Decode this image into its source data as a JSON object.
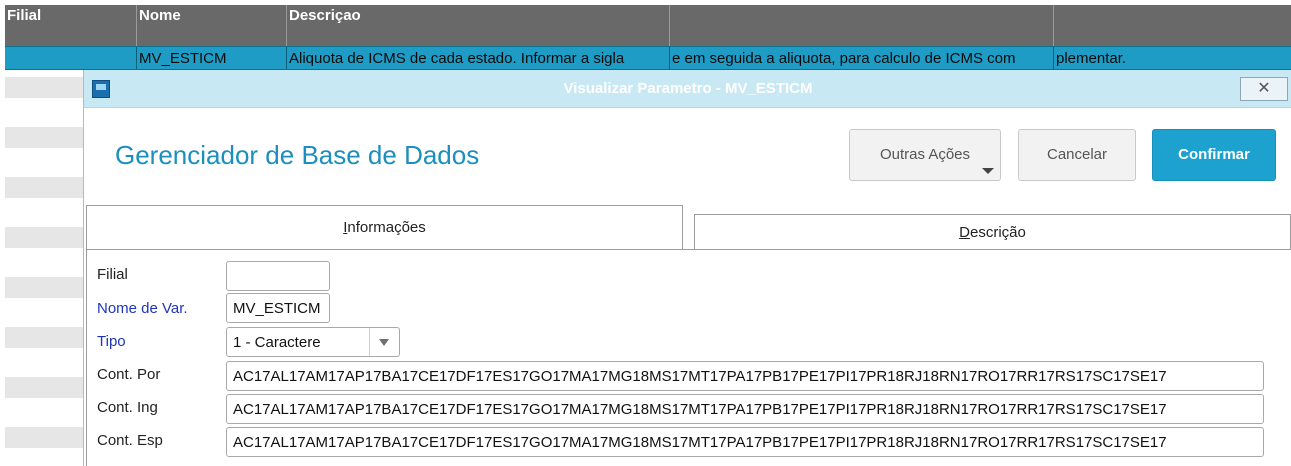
{
  "grid": {
    "headers": [
      "Filial",
      "Nome",
      "Descriçao",
      "",
      ""
    ],
    "selected_row": [
      "",
      "MV_ESTICM",
      "Aliquota de ICMS de cada estado. Informar a sigla",
      "e em seguida a aliquota, para calculo de ICMS com",
      "plementar."
    ]
  },
  "dialog": {
    "title": "Visualizar Parametro - MV_ESTICM",
    "close_glyph": "✕",
    "page_title": "Gerenciador de Base de Dados",
    "buttons": {
      "outras": "Outras Ações",
      "cancelar": "Cancelar",
      "confirmar": "Confirmar"
    },
    "tabs": {
      "informacoes_first": "I",
      "informacoes_rest": "nformações",
      "descricao_first": "D",
      "descricao_rest": "escrição"
    },
    "form": {
      "filial_label": "Filial",
      "filial_value": "",
      "nome_label": "Nome de Var.",
      "nome_value": "MV_ESTICM",
      "tipo_label": "Tipo",
      "tipo_value": "1 - Caractere",
      "cont_por_label": "Cont. Por",
      "cont_por_value": "AC17AL17AM17AP17BA17CE17DF17ES17GO17MA17MG18MS17MT17PA17PB17PE17PI17PR18RJ18RN17RO17RR17RS17SC17SE17",
      "cont_ing_label": "Cont. Ing",
      "cont_ing_value": "AC17AL17AM17AP17BA17CE17DF17ES17GO17MA17MG18MS17MT17PA17PB17PE17PI17PR18RJ18RN17RO17RR17RS17SC17SE17",
      "cont_esp_label": "Cont. Esp",
      "cont_esp_value": "AC17AL17AM17AP17BA17CE17DF17ES17GO17MA17MG18MS17MT17PA17PB17PE17PI17PR18RJ18RN17RO17RR17RS17SC17SE17"
    }
  },
  "colors": {
    "grid_header": "#696969",
    "selected_row": "#1f9cc6",
    "titlebar": "#c8e8f4",
    "accent": "#1c8fbe",
    "confirm": "#1da1cf",
    "required_label": "#1f35b8"
  },
  "icons": {
    "window": "app-window-icon",
    "close": "close-icon",
    "dropdown": "chevron-down-icon"
  }
}
